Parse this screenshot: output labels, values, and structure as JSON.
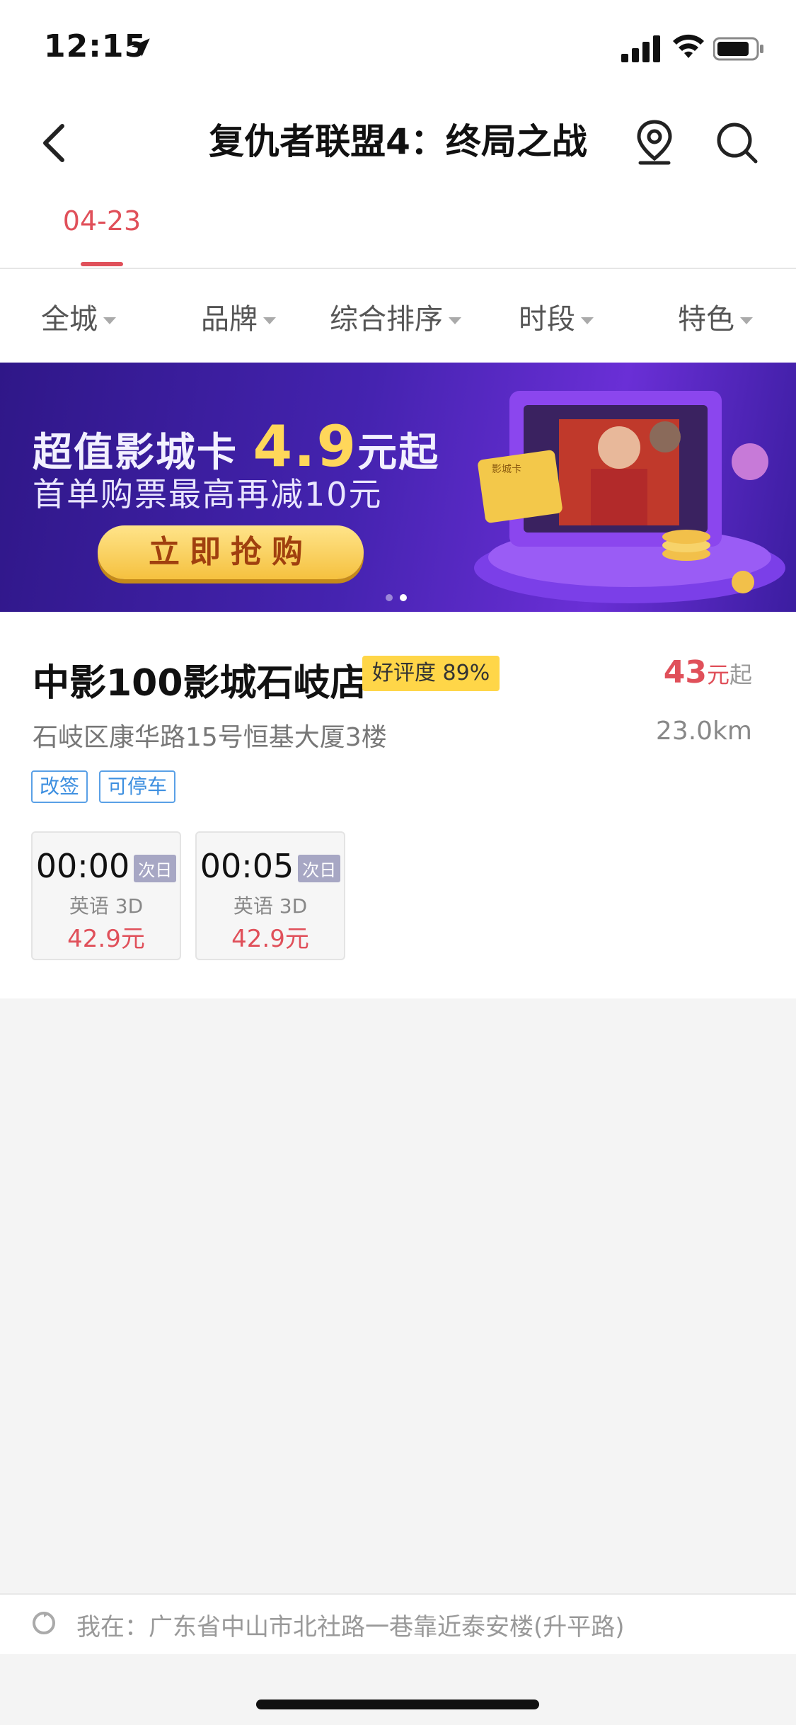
{
  "status_bar": {
    "time": "12:15"
  },
  "nav": {
    "title": "复仇者联盟4：终局之战"
  },
  "date_tab": {
    "label": "04-23"
  },
  "filters": [
    "全城",
    "品牌",
    "综合排序",
    "时段",
    "特色"
  ],
  "banner": {
    "title_prefix": "超值影城卡",
    "title_price": "4.9",
    "title_suffix": "元起",
    "subtitle": "首单购票最高再减10元",
    "button": "立即抢购",
    "card_label": "影城卡"
  },
  "cinema": {
    "name": "中影100影城石岐店",
    "rating": "好评度 89%",
    "price": "43",
    "price_unit": "元",
    "price_suffix": "起",
    "address": "石岐区康华路15号恒基大厦3楼",
    "distance": "23.0km",
    "tags": [
      "改签",
      "可停车"
    ],
    "showtimes": [
      {
        "time": "00:00",
        "next_day": "次日",
        "lang": "英语 3D",
        "price": "42.9元"
      },
      {
        "time": "00:05",
        "next_day": "次日",
        "lang": "英语 3D",
        "price": "42.9元"
      }
    ]
  },
  "location_bar": {
    "text": "我在：广东省中山市北社路一巷靠近泰安楼(升平路)"
  },
  "colors": {
    "accent": "#e0505a",
    "tag_blue": "#3d8fe0",
    "rating_yellow": "#ffd648"
  }
}
